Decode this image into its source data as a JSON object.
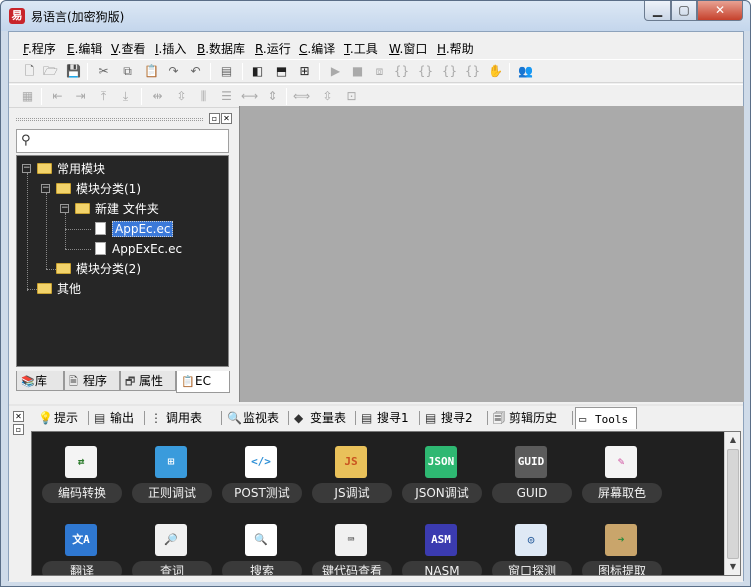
{
  "window": {
    "title": "易语言(加密狗版)",
    "app_icon": "app-logo-icon",
    "buttons": {
      "minimize": "▁",
      "maximize": "▢",
      "close": "✕"
    }
  },
  "menu": [
    {
      "key": "F",
      "label": ".程序"
    },
    {
      "key": "E",
      "label": ".编辑"
    },
    {
      "key": "V",
      "label": ".查看"
    },
    {
      "key": "I",
      "label": ".插入"
    },
    {
      "key": "B",
      "label": ".数据库"
    },
    {
      "key": "R",
      "label": ".运行"
    },
    {
      "key": "C",
      "label": ".编译"
    },
    {
      "key": "T",
      "label": ".工具"
    },
    {
      "key": "W",
      "label": ".窗口"
    },
    {
      "key": "H",
      "label": ".帮助"
    }
  ],
  "toolbar1": [
    {
      "name": "new-file-icon",
      "glyph": "🗋"
    },
    {
      "name": "open-folder-icon",
      "glyph": "🗁"
    },
    {
      "name": "save-icon",
      "glyph": "💾"
    },
    {
      "name": "cut-icon",
      "glyph": "✂"
    },
    {
      "name": "copy-icon",
      "glyph": "⧉"
    },
    {
      "name": "paste-icon",
      "glyph": "📋"
    },
    {
      "name": "redo-icon",
      "glyph": "↷"
    },
    {
      "name": "undo-icon",
      "glyph": "↶"
    },
    {
      "name": "find-icon",
      "glyph": "▤"
    },
    {
      "name": "layout-left-icon",
      "glyph": "◧"
    },
    {
      "name": "layout-top-icon",
      "glyph": "⬒"
    },
    {
      "name": "layout-grid-icon",
      "glyph": "⊞"
    },
    {
      "name": "run-icon",
      "glyph": "▶"
    },
    {
      "name": "stop-icon",
      "glyph": "■"
    },
    {
      "name": "step-icon",
      "glyph": "⧈"
    },
    {
      "name": "step-into-icon",
      "glyph": "{}"
    },
    {
      "name": "step-over-icon",
      "glyph": "{}"
    },
    {
      "name": "step-out-icon",
      "glyph": "{}"
    },
    {
      "name": "run-to-cursor-icon",
      "glyph": "{}"
    },
    {
      "name": "hand-icon",
      "glyph": "✋"
    },
    {
      "name": "debug-people-icon",
      "glyph": "👥"
    }
  ],
  "toolbar2": [
    {
      "name": "form-icon",
      "glyph": "▦"
    },
    {
      "name": "align-left-icon",
      "glyph": "⇤"
    },
    {
      "name": "align-right-icon",
      "glyph": "⇥"
    },
    {
      "name": "align-top-icon",
      "glyph": "⤒"
    },
    {
      "name": "align-bottom-icon",
      "glyph": "⤓"
    },
    {
      "name": "center-horizontal-icon",
      "glyph": "⇹"
    },
    {
      "name": "center-vertical-icon",
      "glyph": "⇳"
    },
    {
      "name": "distribute-horizontal-icon",
      "glyph": "⫼"
    },
    {
      "name": "distribute-vertical-icon",
      "glyph": "☰"
    },
    {
      "name": "space-horizontal-icon",
      "glyph": "⟷"
    },
    {
      "name": "space-vertical-icon",
      "glyph": "⇕"
    },
    {
      "name": "same-width-icon",
      "glyph": "⟺"
    },
    {
      "name": "same-height-icon",
      "glyph": "⇳"
    },
    {
      "name": "same-size-icon",
      "glyph": "⊡"
    }
  ],
  "left_pane": {
    "search_placeholder": "",
    "tree": [
      {
        "label": "常用模块",
        "type": "folder",
        "expander": "−",
        "level": 0
      },
      {
        "label": "模块分类(1)",
        "type": "folder",
        "expander": "−",
        "level": 1
      },
      {
        "label": "新建 文件夹",
        "type": "folder",
        "expander": "−",
        "level": 2
      },
      {
        "label": "AppEc.ec",
        "type": "file",
        "selected": true,
        "level": 3
      },
      {
        "label": "AppExEc.ec",
        "type": "file",
        "level": 3
      },
      {
        "label": "模块分类(2)",
        "type": "folder",
        "level": 1
      },
      {
        "label": "其他",
        "type": "folder",
        "level": 0
      }
    ],
    "tabs": [
      {
        "label": "库",
        "icon": "library-icon",
        "glyph": "📚"
      },
      {
        "label": "程序",
        "icon": "program-icon",
        "glyph": "🗎"
      },
      {
        "label": "属性",
        "icon": "property-icon",
        "glyph": "🗗"
      },
      {
        "label": "EC",
        "icon": "ec-icon",
        "glyph": "📋",
        "active": true
      }
    ]
  },
  "bottom_pane": {
    "tabs": [
      {
        "label": "提示",
        "icon": "hint-icon",
        "glyph": "💡"
      },
      {
        "label": "输出",
        "icon": "output-icon",
        "glyph": "▤"
      },
      {
        "label": "调用表",
        "icon": "call-table-icon",
        "glyph": "⋮⋮"
      },
      {
        "label": "监视表",
        "icon": "watch-icon",
        "glyph": "🔍"
      },
      {
        "label": "变量表",
        "icon": "variable-icon",
        "glyph": "◆"
      },
      {
        "label": "搜寻1",
        "icon": "search1-icon",
        "glyph": "▤"
      },
      {
        "label": "搜寻2",
        "icon": "search2-icon",
        "glyph": "▤"
      },
      {
        "label": "剪辑历史",
        "icon": "clip-history-icon",
        "glyph": "🗐"
      },
      {
        "label": "Tools",
        "icon": "tools-window-icon",
        "glyph": "▭",
        "active": true
      }
    ],
    "tools": [
      {
        "label": "编码转换",
        "icon": "encoding-convert-icon",
        "bg": "#f4f4f4",
        "fg": "#2a7a2a",
        "glyph": "⇄"
      },
      {
        "label": "正则调试",
        "icon": "regex-debug-icon",
        "bg": "#3a9bdc",
        "fg": "#ffffff",
        "glyph": "⊞"
      },
      {
        "label": "POST测试",
        "icon": "post-test-icon",
        "bg": "#ffffff",
        "fg": "#2d8fd6",
        "glyph": "</>"
      },
      {
        "label": "JS调试",
        "icon": "js-debug-icon",
        "bg": "#e9c15a",
        "fg": "#c9531f",
        "glyph": "JS"
      },
      {
        "label": "JSON调试",
        "icon": "json-debug-icon",
        "bg": "#2eb872",
        "fg": "#ffffff",
        "glyph": "JSON"
      },
      {
        "label": "GUID",
        "icon": "guid-icon",
        "bg": "#5b5b5b",
        "fg": "#ffffff",
        "glyph": "GUID"
      },
      {
        "label": "屏幕取色",
        "icon": "color-picker-icon",
        "bg": "#f4f4f4",
        "fg": "#d04fa0",
        "glyph": "✎"
      },
      {
        "label": "翻译",
        "icon": "translate-icon",
        "bg": "#2f78d1",
        "fg": "#ffffff",
        "glyph": "文A"
      },
      {
        "label": "查词",
        "icon": "dictionary-icon",
        "bg": "#f1f1f1",
        "fg": "#555555",
        "glyph": "🔎"
      },
      {
        "label": "搜索",
        "icon": "search-tool-icon",
        "bg": "#ffffff",
        "fg": "#333333",
        "glyph": "🔍"
      },
      {
        "label": "键代码查看",
        "icon": "keycode-icon",
        "bg": "#f1f1f1",
        "fg": "#222222",
        "glyph": "⌨"
      },
      {
        "label": "NASM",
        "icon": "nasm-icon",
        "bg": "#3b3bb0",
        "fg": "#ffffff",
        "glyph": "ASM"
      },
      {
        "label": "窗口探测",
        "icon": "window-probe-icon",
        "bg": "#dfe9f5",
        "fg": "#2b5f9e",
        "glyph": "◎"
      },
      {
        "label": "图标提取",
        "icon": "icon-extract-icon",
        "bg": "#c9a56b",
        "fg": "#2a8a3a",
        "glyph": "➜"
      }
    ]
  }
}
